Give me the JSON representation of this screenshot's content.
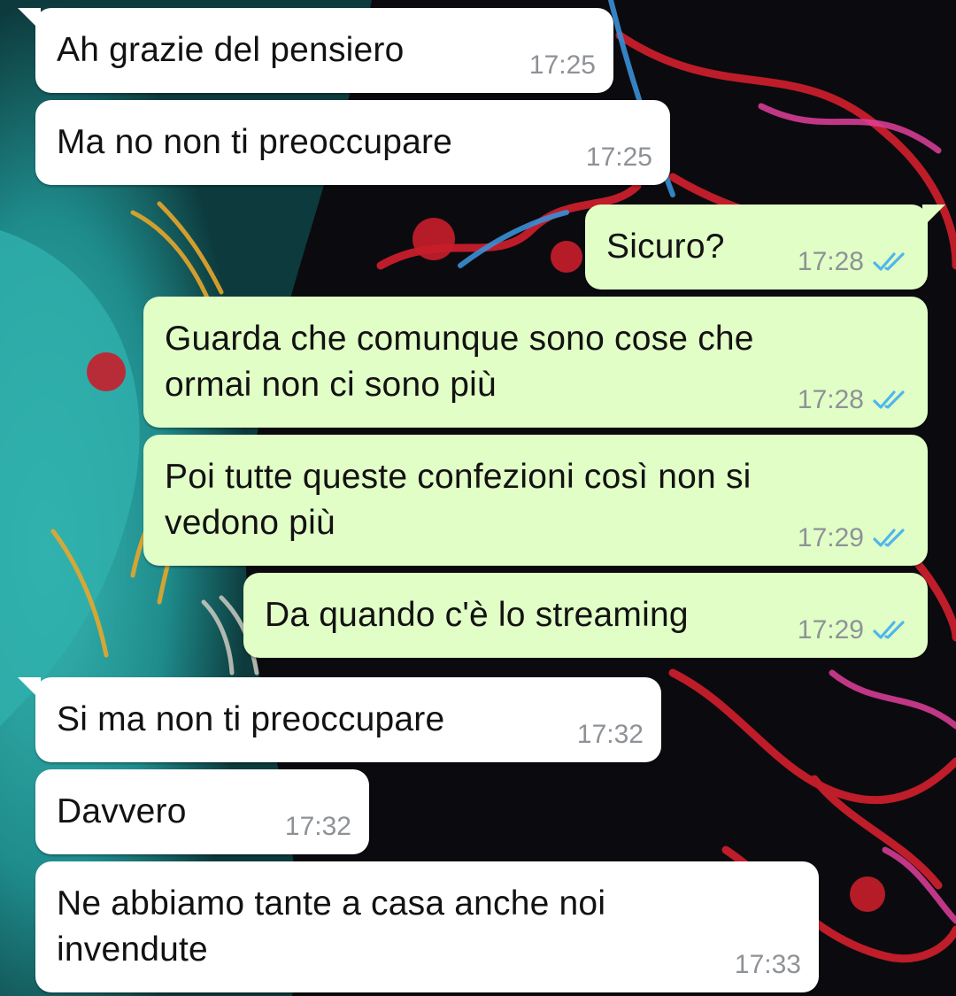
{
  "colors": {
    "incoming_bubble": "#ffffff",
    "outgoing_bubble": "#e1fec6",
    "timestamp": "#8e9297",
    "read_ticks": "#4fb6ec",
    "wallpaper_teal": "#2aa7a5",
    "wallpaper_black": "#0b0b0f",
    "wallpaper_red": "#c81e2b"
  },
  "icons": {
    "read_receipt": "double-check-icon",
    "wallpaper": "decorative-illustration"
  },
  "messages": [
    {
      "direction": "incoming",
      "text": "Ah grazie del pensiero",
      "time": "17:25"
    },
    {
      "direction": "incoming",
      "text": "Ma no non ti preoccupare",
      "time": "17:25"
    },
    {
      "direction": "outgoing",
      "text": "Sicuro?",
      "time": "17:28",
      "read": true
    },
    {
      "direction": "outgoing",
      "text": "Guarda che comunque sono cose che\normai non ci sono più",
      "time": "17:28",
      "read": true
    },
    {
      "direction": "outgoing",
      "text": "Poi tutte queste confezioni così non si\nvedono più",
      "time": "17:29",
      "read": true
    },
    {
      "direction": "outgoing",
      "text": "Da quando c'è lo streaming",
      "time": "17:29",
      "read": true
    },
    {
      "direction": "incoming",
      "text": "Si ma non ti preoccupare",
      "time": "17:32"
    },
    {
      "direction": "incoming",
      "text": "Davvero",
      "time": "17:32"
    },
    {
      "direction": "incoming",
      "text": "Ne abbiamo tante a casa anche noi\ninvendute",
      "time": "17:33"
    }
  ]
}
